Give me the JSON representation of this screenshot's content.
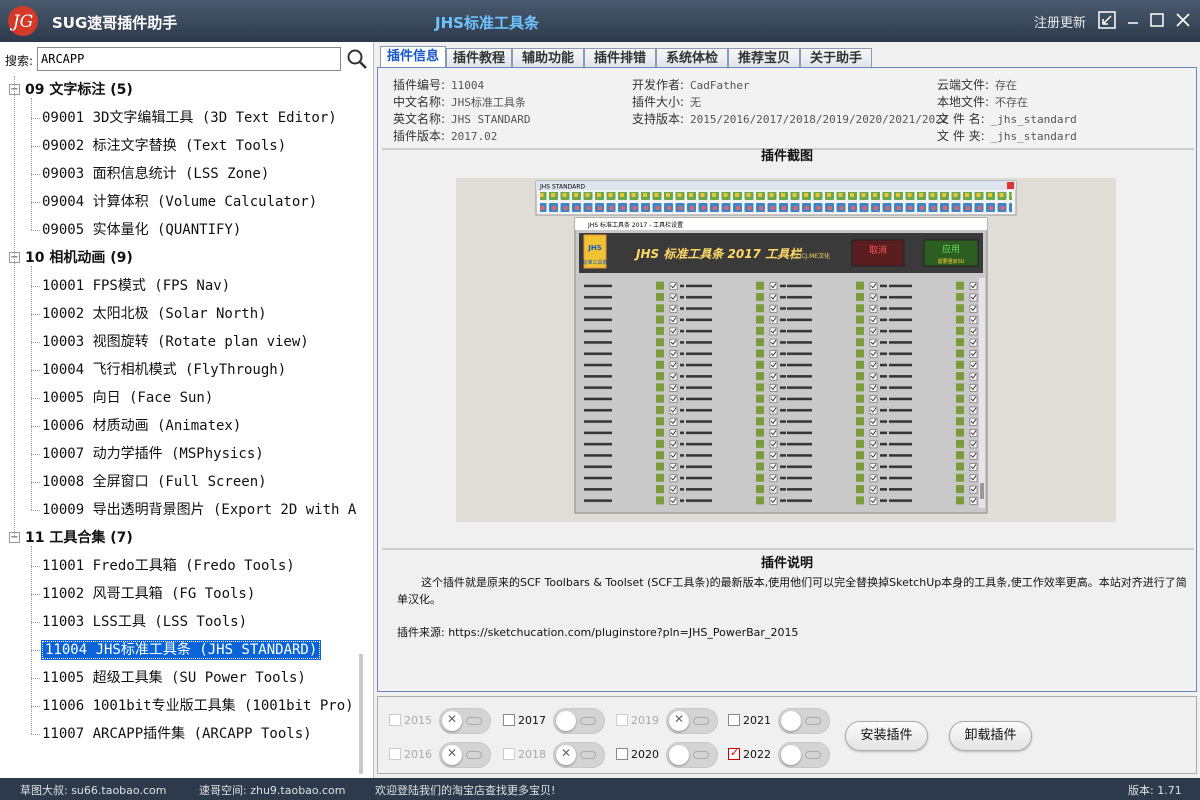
{
  "titlebar": {
    "logo_text": "JG",
    "app_title": "SUG速哥插件助手",
    "center_title": "JHS标准工具条",
    "register_label": "注册更新"
  },
  "search": {
    "label": "搜索:",
    "value": "ARCAPP"
  },
  "tree": {
    "groups": [
      {
        "label": "09  文字标注 (5)",
        "items": [
          "09001 3D文字编辑工具 (3D Text Editor)",
          "09002 标注文字替换 (Text Tools)",
          "09003 面积信息统计 (LSS Zone)",
          "09004 计算体积 (Volume Calculator)",
          "09005 实体量化 (QUANTIFY)"
        ]
      },
      {
        "label": "10  相机动画 (9)",
        "items": [
          "10001 FPS模式 (FPS Nav)",
          "10002 太阳北极 (Solar North)",
          "10003 视图旋转 (Rotate plan view)",
          "10004 飞行相机模式 (FlyThrough)",
          "10005 向日 (Face Sun)",
          "10006 材质动画 (Animatex)",
          "10007 动力学插件 (MSPhysics)",
          "10008 全屏窗口 (Full Screen)",
          "10009 导出透明背景图片 (Export 2D with A"
        ]
      },
      {
        "label": "11  工具合集 (7)",
        "items": [
          "11001 Fredo工具箱 (Fredo Tools)",
          "11002 风哥工具箱 (FG Tools)",
          "11003 LSS工具 (LSS Tools)",
          "11004 JHS标准工具条 (JHS STANDARD)",
          "11005 超级工具集 (SU Power Tools)",
          "11006 1001bit专业版工具集 (1001bit Pro)",
          "11007 ARCAPP插件集 (ARCAPP Tools)"
        ]
      }
    ],
    "selected_item": "11004 JHS标准工具条 (JHS STANDARD)"
  },
  "tabs": [
    "插件信息",
    "插件教程",
    "辅助功能",
    "插件排错",
    "系统体检",
    "推荐宝贝",
    "关于助手"
  ],
  "active_tab": "插件信息",
  "info": {
    "col1": [
      {
        "k": "插件编号:",
        "v": "11004"
      },
      {
        "k": "中文名称:",
        "v": "JHS标准工具条"
      },
      {
        "k": "英文名称:",
        "v": "JHS STANDARD"
      },
      {
        "k": "插件版本:",
        "v": "2017.02"
      }
    ],
    "col2": [
      {
        "k": "开发作者:",
        "v": "CadFather"
      },
      {
        "k": "插件大小:",
        "v": "无"
      },
      {
        "k": "支持版本:",
        "v": "2015/2016/2017/2018/2019/2020/2021/2022"
      }
    ],
    "col3": [
      {
        "k": "云端文件:",
        "v": "存在"
      },
      {
        "k": "本地文件:",
        "v": "不存在"
      },
      {
        "k": "文 件 名:",
        "v": "_jhs_standard"
      },
      {
        "k": "文 件 夹:",
        "v": "_jhs_standard"
      }
    ]
  },
  "screenshot": {
    "title": "插件截图",
    "toolbar_title": "JHS STANDARD",
    "dialog_title": "JHS 标准工具条 2017 - 工具栏设置",
    "dialog_logo": "JHS",
    "dialog_logo_sub": "标准工具条",
    "dialog_heading": "JHS 标准工具条 2017 工具栏",
    "dialog_credit": "SUCJ.ME汉化",
    "cancel_label": "取消",
    "apply_label": "应用",
    "apply_sub": "需要重启SU"
  },
  "description": {
    "title": "插件说明",
    "text": "这个插件就是原来的SCF Toolbars & Toolset (SCF工具条)的最新版本,使用他们可以完全替换掉SketchUp本身的工具条,使工作效率更高。本站对齐进行了简单汉化。",
    "source": "插件来源: https://sketchucation.com/pluginstore?pln=JHS_PowerBar_2015"
  },
  "versions": [
    {
      "year": "2015",
      "enabled": false,
      "checked": false,
      "toggle_on": false
    },
    {
      "year": "2017",
      "enabled": true,
      "checked": false,
      "toggle_on": false
    },
    {
      "year": "2019",
      "enabled": false,
      "checked": false,
      "toggle_on": false
    },
    {
      "year": "2021",
      "enabled": true,
      "checked": false,
      "toggle_on": false
    },
    {
      "year": "2016",
      "enabled": false,
      "checked": false,
      "toggle_on": false
    },
    {
      "year": "2018",
      "enabled": false,
      "checked": false,
      "toggle_on": false
    },
    {
      "year": "2020",
      "enabled": true,
      "checked": false,
      "toggle_on": false
    },
    {
      "year": "2022",
      "enabled": true,
      "checked": true,
      "toggle_on": false
    }
  ],
  "buttons": {
    "install": "安装插件",
    "uninstall": "卸载插件"
  },
  "status": {
    "left": "草图大叔: su66.taobao.com",
    "mid": "速哥空间: zhu9.taobao.com",
    "msg": "欢迎登陆我们的淘宝店查找更多宝贝!",
    "version": "版本: 1.71"
  },
  "colors": {
    "titlebar": "#2d3a4c",
    "accent": "#0a64d8",
    "center_title": "#6fc3ff",
    "panel_border": "#6b87c4"
  }
}
